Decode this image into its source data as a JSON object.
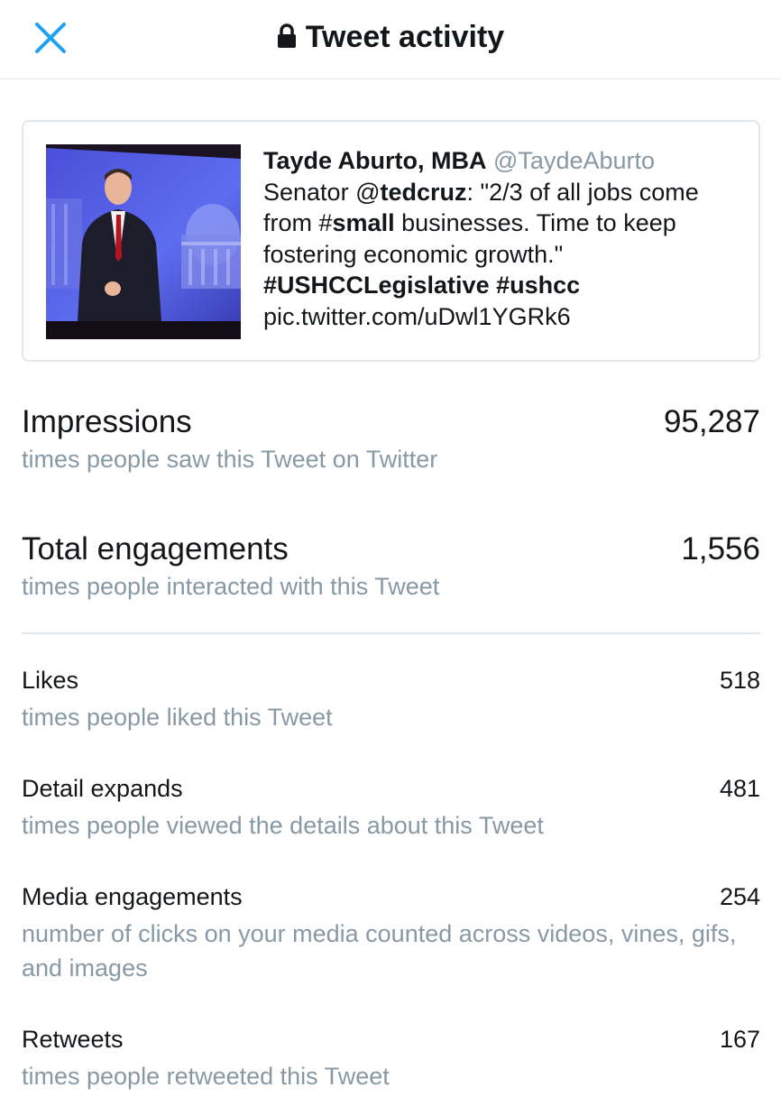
{
  "header": {
    "title": "Tweet activity"
  },
  "tweet": {
    "author_name": "Tayde Aburto, MBA",
    "author_handle": "@TaydeAburto",
    "text_1": "Senator @",
    "mention": "tedcruz",
    "text_2": ": \"2/3 of all jobs come from #",
    "hashtag_small": "small",
    "text_3": " businesses. Time to keep fostering economic growth.\" ",
    "hashtag_1": "#USHCCLegislative",
    "text_4": " ",
    "hashtag_2": "#ushcc",
    "text_5": " pic.twitter.com/uDwl1YGRk6"
  },
  "metrics": {
    "impressions": {
      "label": "Impressions",
      "value": "95,287",
      "desc": "times people saw this Tweet on Twitter"
    },
    "engagements": {
      "label": "Total engagements",
      "value": "1,556",
      "desc": "times people interacted with this Tweet"
    },
    "likes": {
      "label": "Likes",
      "value": "518",
      "desc": "times people liked this Tweet"
    },
    "detail_expands": {
      "label": "Detail expands",
      "value": "481",
      "desc": "times people viewed the details about this Tweet"
    },
    "media_engagements": {
      "label": "Media engagements",
      "value": "254",
      "desc": "number of clicks on your media counted across videos, vines, gifs, and images"
    },
    "retweets": {
      "label": "Retweets",
      "value": "167",
      "desc": "times people retweeted this Tweet"
    }
  },
  "colors": {
    "accent": "#1da1f2",
    "secondary_text": "#8899a6",
    "divider": "#e1e8ed"
  }
}
